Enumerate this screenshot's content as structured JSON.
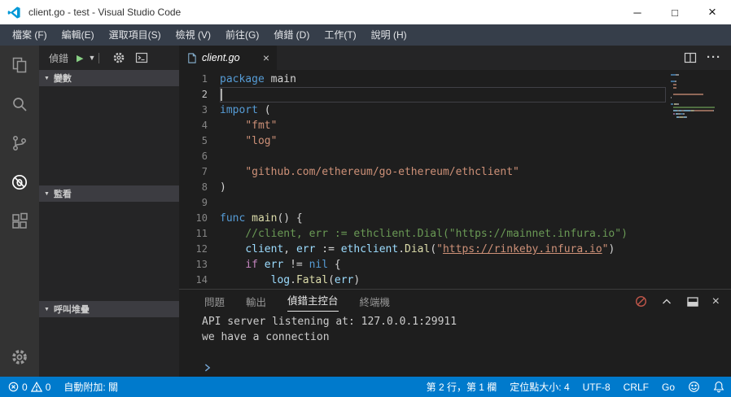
{
  "title_bar": {
    "title": "client.go - test - Visual Studio Code",
    "controls": {
      "minimize": "─",
      "maximize": "□",
      "close": "×"
    }
  },
  "menu_bar": {
    "items": [
      "檔案 (F)",
      "編輯(E)",
      "選取項目(S)",
      "檢視 (V)",
      "前往(G)",
      "偵錯 (D)",
      "工作(T)",
      "說明 (H)"
    ]
  },
  "activity_bar": {
    "items": [
      {
        "name": "explorer",
        "icon": "files-icon",
        "active": false
      },
      {
        "name": "search",
        "icon": "search-icon",
        "active": false
      },
      {
        "name": "source-control",
        "icon": "git-branch-icon",
        "active": false
      },
      {
        "name": "debug",
        "icon": "debug-icon",
        "active": true
      },
      {
        "name": "extensions",
        "icon": "extensions-icon",
        "active": false
      }
    ],
    "bottom_items": [
      {
        "name": "manage",
        "icon": "gear-icon"
      }
    ]
  },
  "sidebar": {
    "title": "偵錯",
    "sections": [
      {
        "label": "變數"
      },
      {
        "label": "監看"
      },
      {
        "label": "呼叫堆疊"
      }
    ]
  },
  "editor": {
    "tab": {
      "label": "client.go",
      "close_glyph": "×"
    },
    "current_line": 2,
    "lines": [
      {
        "n": 1,
        "seg": [
          [
            "k",
            "package"
          ],
          [
            "p",
            " main"
          ]
        ]
      },
      {
        "n": 2,
        "seg": []
      },
      {
        "n": 3,
        "seg": [
          [
            "k",
            "import"
          ],
          [
            "p",
            " ("
          ]
        ]
      },
      {
        "n": 4,
        "seg": [
          [
            "p",
            "    "
          ],
          [
            "s",
            "\"fmt\""
          ]
        ]
      },
      {
        "n": 5,
        "seg": [
          [
            "p",
            "    "
          ],
          [
            "s",
            "\"log\""
          ]
        ]
      },
      {
        "n": 6,
        "seg": []
      },
      {
        "n": 7,
        "seg": [
          [
            "p",
            "    "
          ],
          [
            "s",
            "\"github.com/ethereum/go-ethereum/ethclient\""
          ]
        ]
      },
      {
        "n": 8,
        "seg": [
          [
            "p",
            ")"
          ]
        ]
      },
      {
        "n": 9,
        "seg": []
      },
      {
        "n": 10,
        "seg": [
          [
            "k",
            "func"
          ],
          [
            "p",
            " "
          ],
          [
            "f",
            "main"
          ],
          [
            "p",
            "() {"
          ]
        ]
      },
      {
        "n": 11,
        "seg": [
          [
            "p",
            "    "
          ],
          [
            "c",
            "//client, err := ethclient.Dial(\"https://mainnet.infura.io\")"
          ]
        ]
      },
      {
        "n": 12,
        "seg": [
          [
            "p",
            "    "
          ],
          [
            "v",
            "client"
          ],
          [
            "p",
            ", "
          ],
          [
            "v",
            "err"
          ],
          [
            "p",
            " := "
          ],
          [
            "v",
            "ethclient"
          ],
          [
            "p",
            "."
          ],
          [
            "f",
            "Dial"
          ],
          [
            "p",
            "("
          ],
          [
            "s",
            "\""
          ],
          [
            "u",
            "https://rinkeby.infura.io"
          ],
          [
            "s",
            "\""
          ],
          [
            "p",
            ")"
          ]
        ]
      },
      {
        "n": 13,
        "seg": [
          [
            "p",
            "    "
          ],
          [
            "ctl",
            "if"
          ],
          [
            "p",
            " "
          ],
          [
            "v",
            "err"
          ],
          [
            "p",
            " != "
          ],
          [
            "k",
            "nil"
          ],
          [
            "p",
            " {"
          ]
        ]
      },
      {
        "n": 14,
        "seg": [
          [
            "p",
            "        "
          ],
          [
            "v",
            "log"
          ],
          [
            "p",
            "."
          ],
          [
            "f",
            "Fatal"
          ],
          [
            "p",
            "("
          ],
          [
            "v",
            "err"
          ],
          [
            "p",
            ")"
          ]
        ]
      }
    ]
  },
  "panel": {
    "tabs": [
      {
        "name": "problems",
        "label": "問題",
        "active": false
      },
      {
        "name": "output",
        "label": "輸出",
        "active": false
      },
      {
        "name": "debug-console",
        "label": "偵錯主控台",
        "active": true
      },
      {
        "name": "terminal",
        "label": "終端機",
        "active": false
      }
    ],
    "console_lines": [
      "API server listening at: 127.0.0.1:29911",
      "we have a connection"
    ]
  },
  "status_bar": {
    "error_count": "0",
    "warning_count": "0",
    "auto_attach": "自動附加: 關",
    "right_items": [
      {
        "name": "cursor-position",
        "label": "第 2 行，第 1 欄"
      },
      {
        "name": "tab-size",
        "label": "定位點大小: 4"
      },
      {
        "name": "encoding",
        "label": "UTF-8"
      },
      {
        "name": "eol",
        "label": "CRLF"
      },
      {
        "name": "language-mode",
        "label": "Go"
      }
    ]
  },
  "colors": {
    "status_bar_bg": "#007acc",
    "editor_bg": "#1e1e1e",
    "sidebar_bg": "#252526",
    "activity_bar_bg": "#333333",
    "menu_bar_bg": "#363e4a",
    "keyword": "#569cd6",
    "string": "#ce9178",
    "comment": "#6a9955",
    "function": "#dcdcaa",
    "variable": "#9cdcfe",
    "control": "#c586c0",
    "play_green": "#89d185"
  }
}
